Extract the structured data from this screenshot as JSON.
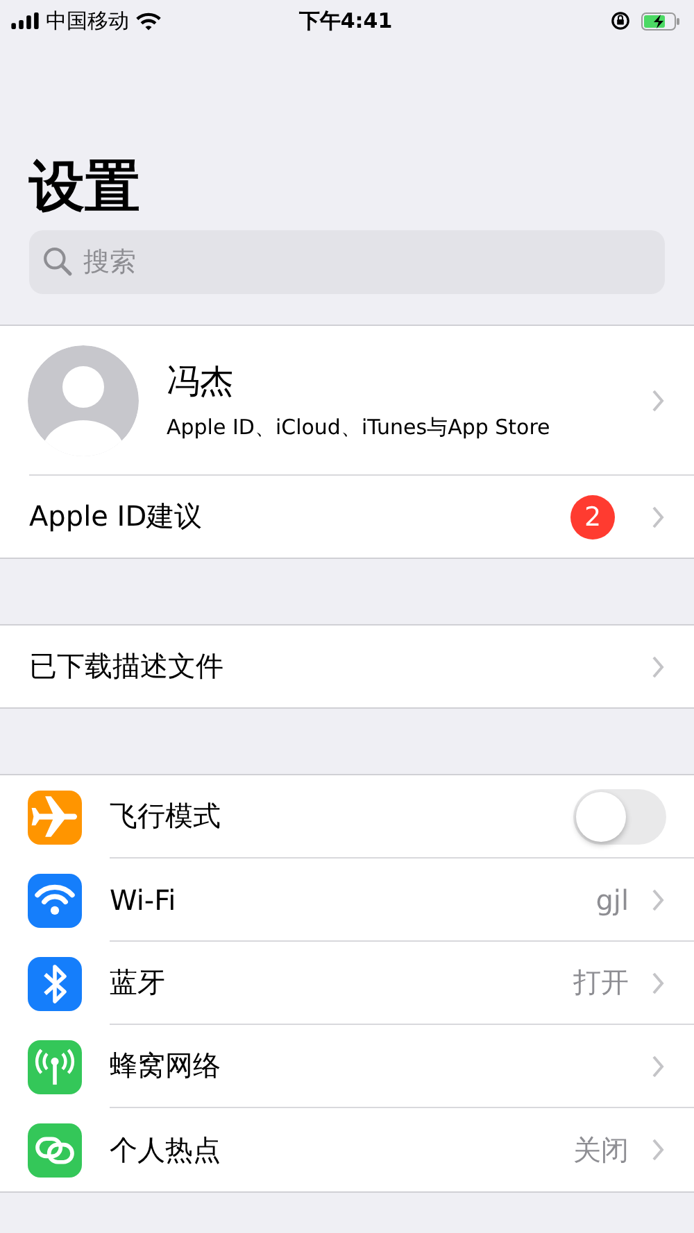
{
  "status_bar": {
    "carrier": "中国移动",
    "time": "下午4:41"
  },
  "title": "设置",
  "search": {
    "placeholder": "搜索"
  },
  "profile": {
    "name": "冯杰",
    "subtitle": "Apple ID、iCloud、iTunes与App Store"
  },
  "suggestion": {
    "label": "Apple ID建议",
    "badge": "2"
  },
  "downloaded": {
    "label": "已下载描述文件"
  },
  "settings": [
    {
      "kind": "toggle",
      "label": "飞行模式",
      "on": false,
      "color": "#ff9500"
    },
    {
      "kind": "link",
      "label": "Wi-Fi",
      "value": "gjl",
      "color": "#157efb"
    },
    {
      "kind": "link",
      "label": "蓝牙",
      "value": "打开",
      "color": "#157efb"
    },
    {
      "kind": "link",
      "label": "蜂窝网络",
      "color": "#34c759"
    },
    {
      "kind": "link",
      "label": "个人热点",
      "value": "关闭",
      "color": "#34c759"
    }
  ]
}
